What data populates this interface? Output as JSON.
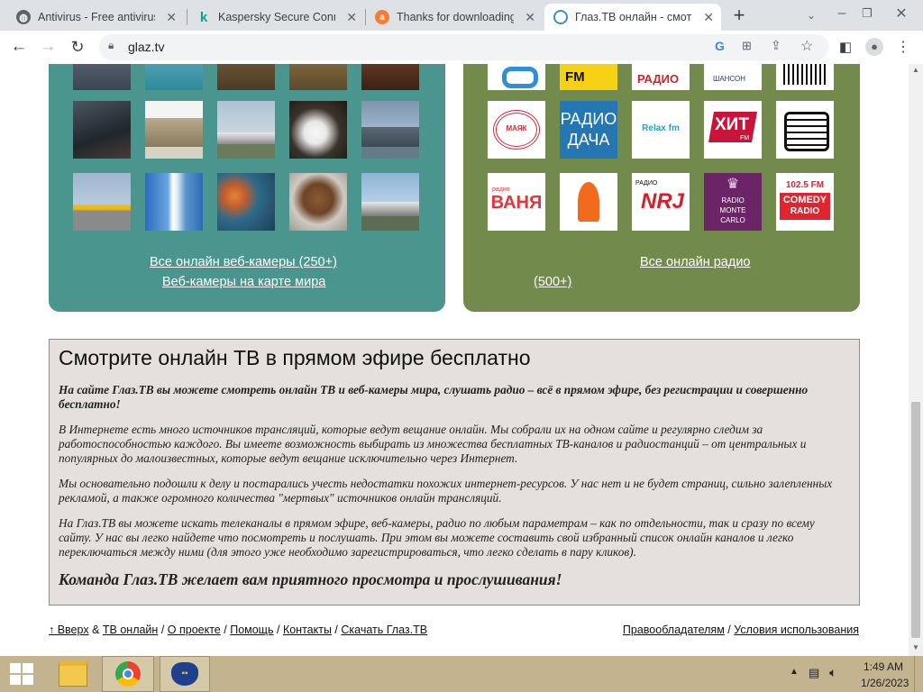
{
  "tabs": [
    {
      "title": "Antivirus - Free antivirus"
    },
    {
      "title": "Kaspersky Secure Connec"
    },
    {
      "title": "Thanks for downloading"
    },
    {
      "title": "Глаз.ТВ онлайн - смотре"
    }
  ],
  "toolbar": {
    "url": "glaz.tv"
  },
  "cams": {
    "all_link": "Все онлайн веб-камеры (250+)",
    "map_link": "Веб-камеры на карте мира"
  },
  "radio": {
    "all_link_1": "Все онлайн радио",
    "all_link_2": "(500+)",
    "logos": {
      "fm": "FM",
      "radio_top": "РАДИО",
      "shanson": "ШАНСОН",
      "mayak": "МАЯК",
      "dacha_1": "РАДИО",
      "dacha_2": "ДАЧА",
      "relax": "Relax fm",
      "hit": "ХИТ",
      "hit_sub": "FM",
      "vanya_small": "радио",
      "vanya": "ВАНЯ",
      "nrj": "NRJ",
      "nrj_small": "РАДИО",
      "rmc_1": "RADIO",
      "rmc_2": "MONTE",
      "rmc_3": "CARLO",
      "comedy_1": "102.5 FM",
      "comedy_2": "COMEDY",
      "comedy_3": "RADIO"
    }
  },
  "info": {
    "heading": "Смотрите онлайн ТВ в прямом эфире бесплатно",
    "p1": "На сайте Глаз.ТВ вы можете смотреть онлайн ТВ и веб-камеры мира, слушать радио – всё в прямом эфире, без регистрации и совершенно бесплатно!",
    "p2": "В Интернете есть много источников трансляций, которые ведут вещание онлайн. Мы собрали их на одном сайте и регулярно следим за работоспособностью каждого. Вы имеете возможность выбирать из множества бесплатных ТВ-каналов и радиостанций – от центральных и популярных до малоизвестных, которые ведут вещание исключительно через Интернет.",
    "p3": "Мы основательно подошли к делу и постарались учесть недостатки похожих интернет-ресурсов. У нас нет и не будет страниц, сильно залепленных рекламой, а также огромного количества \"мертвых\" источников онлайн трансляций.",
    "p4": "На Глаз.ТВ вы можете искать телеканалы в прямом эфире, веб-камеры, радио по любым параметрам – как по отдельности, так и сразу по всему сайту. У нас вы легко найдете что посмотреть и послушать. При этом вы можете составить свой избранный список онлайн каналов и легко переключаться между ними (для этого уже необходимо зарегистрироваться, что легко сделать в пару кликов).",
    "p5": "Команда Глаз.ТВ желает вам приятного просмотра и прослушивания!"
  },
  "footer": {
    "up": "↑ Вверх",
    "amp": "&",
    "tv": "ТВ онлайн",
    "sep": "/",
    "about": "О проекте",
    "help": "Помощь",
    "contacts": "Контакты",
    "download": "Скачать Глаз.ТВ",
    "rights": "Правообладателям",
    "terms": "Условия использования"
  },
  "taskbar": {
    "time": "1:49 AM",
    "date": "1/26/2023"
  },
  "colors": {
    "cams_bg": "#4a958e",
    "radio_bg": "#728a4b",
    "info_bg": "#e5e0de",
    "taskbar": "#c3b48f"
  }
}
